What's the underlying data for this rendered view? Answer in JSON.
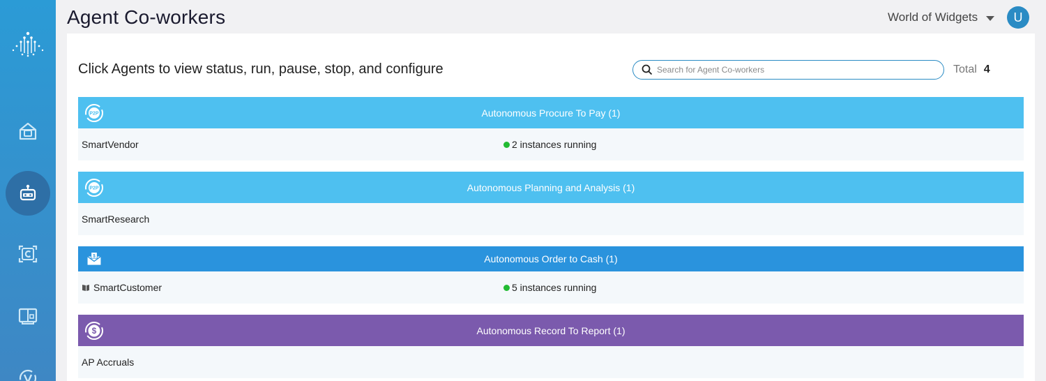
{
  "header": {
    "title": "Agent Co-workers",
    "org": "World of Widgets",
    "avatar_initial": "U"
  },
  "sidebar": {
    "items": [
      {
        "icon": "home-icon"
      },
      {
        "icon": "robot-icon",
        "active": true
      },
      {
        "icon": "c-frame-icon"
      },
      {
        "icon": "book-icon"
      },
      {
        "icon": "v-cycle-icon"
      }
    ]
  },
  "main": {
    "instructions": "Click Agents to view status, run, pause, stop, and configure",
    "search": {
      "placeholder": "Search for Agent Co-workers"
    },
    "total_label": "Total",
    "total_value": "4",
    "groups": [
      {
        "title": "Autonomous Procure To Pay (1)",
        "color": "#4ec0f0",
        "icon": "p2p-icon",
        "agents": [
          {
            "name": "SmartVendor",
            "status": "2 instances running"
          }
        ]
      },
      {
        "title": "Autonomous Planning and Analysis (1)",
        "color": "#4ec0f0",
        "icon": "p2p-icon",
        "agents": [
          {
            "name": "SmartResearch",
            "status": ""
          }
        ]
      },
      {
        "title": "Autonomous Order to Cash (1)",
        "color": "#2a93dd",
        "icon": "cash-envelope-icon",
        "agents": [
          {
            "name": "SmartCustomer",
            "status": "5 instances running"
          }
        ]
      },
      {
        "title": "Autonomous Record To Report (1)",
        "color": "#7b5aad",
        "icon": "dollar-cycle-icon",
        "agents": [
          {
            "name": "AP Accruals",
            "status": ""
          }
        ]
      }
    ]
  }
}
